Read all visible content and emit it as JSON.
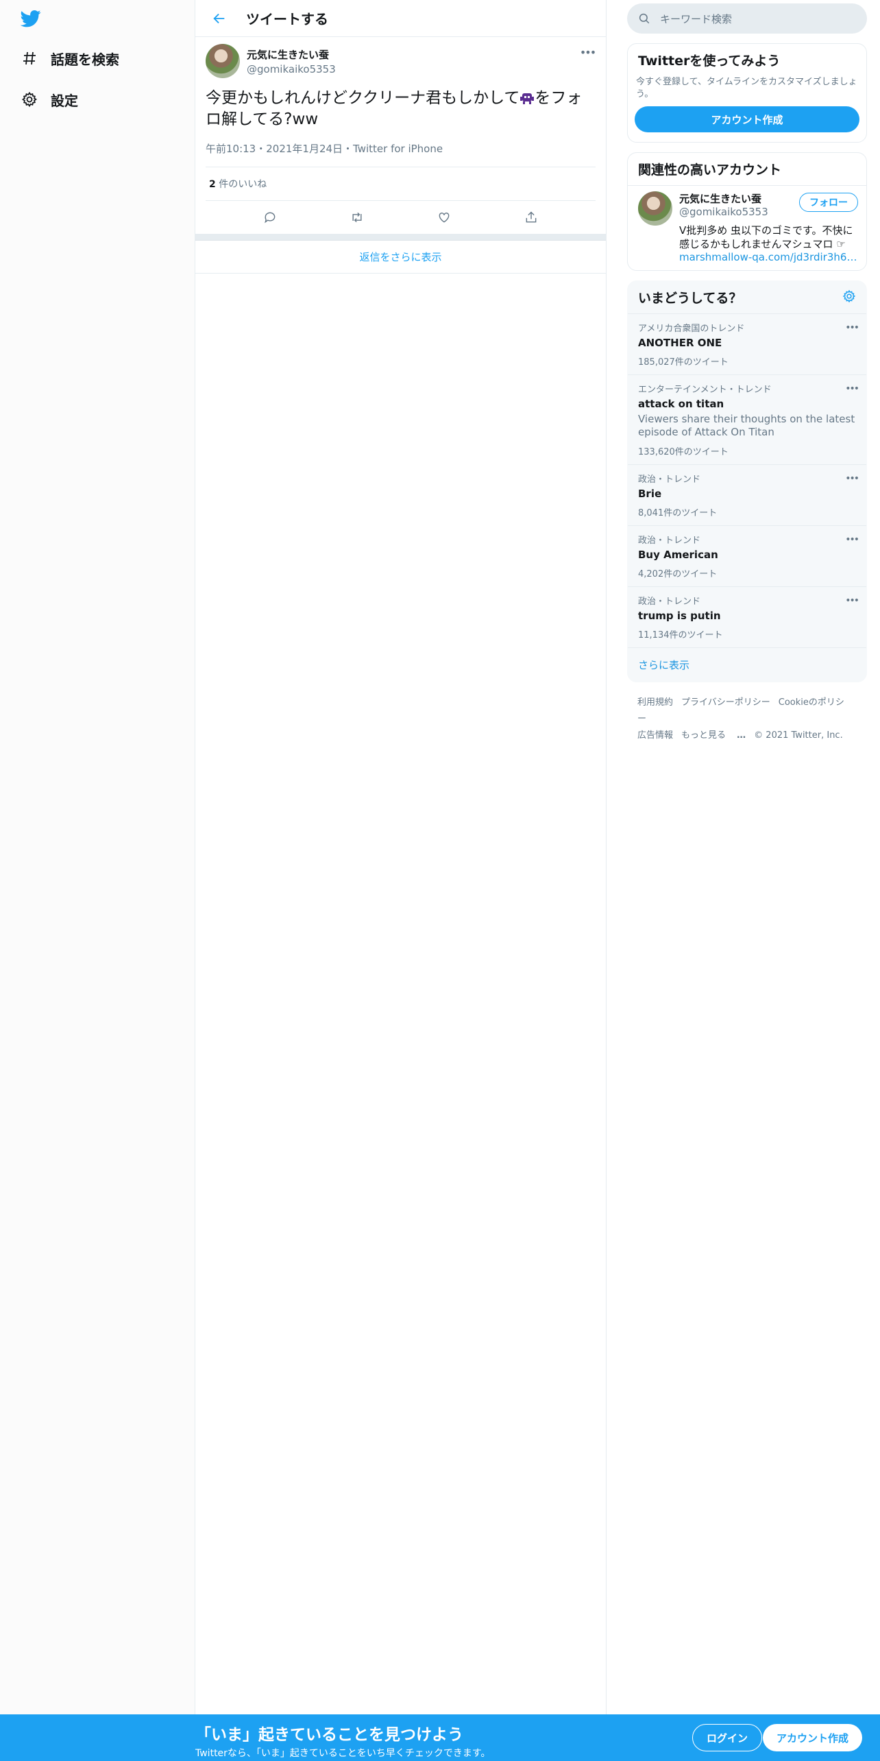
{
  "nav": {
    "items": [
      {
        "label": "話題を検索",
        "icon": "hashtag-icon"
      },
      {
        "label": "設定",
        "icon": "gear-icon"
      }
    ]
  },
  "header": {
    "title": "ツイートする"
  },
  "tweet": {
    "author_name": "元気に生きたい蚕",
    "author_handle": "@gomikaiko5353",
    "text_before": "今更かもしれんけどククリーナ君もしかして",
    "text_after": "をフォロ解してる?ww",
    "meta": "午前10:13・2021年1月24日・Twitter for iPhone",
    "likes_count": "2",
    "likes_label": "件のいいね"
  },
  "show_more_replies": "返信をさらに表示",
  "sidebar": {
    "search_placeholder": "キーワード検索",
    "signup_card": {
      "title": "Twitterを使ってみよう",
      "desc": "今すぐ登録して、タイムラインをカスタマイズしましょう。",
      "button": "アカウント作成"
    },
    "related": {
      "title": "関連性の高いアカウント",
      "name": "元気に生きたい蚕",
      "handle": "@gomikaiko5353",
      "follow": "フォロー",
      "bio_line1": "V批判多め 虫以下のゴミです。不快に",
      "bio_line2": "感じるかもしれませんマシュマロ ☞",
      "link": "marshmallow-qa.com/jd3rdir3h65t2qa…"
    },
    "trends": {
      "title": "いまどうしてる？",
      "items": [
        {
          "context": "アメリカ合衆国のトレンド",
          "name": "ANOTHER ONE",
          "desc": "",
          "count": "185,027件のツイート"
        },
        {
          "context": "エンターテインメント・トレンド",
          "name": "attack on titan",
          "desc": "Viewers share their thoughts on the latest episode of Attack On Titan",
          "count": "133,620件のツイート"
        },
        {
          "context": "政治・トレンド",
          "name": "Brie",
          "desc": "",
          "count": "8,041件のツイート"
        },
        {
          "context": "政治・トレンド",
          "name": "Buy American",
          "desc": "",
          "count": "4,202件のツイート"
        },
        {
          "context": "政治・トレンド",
          "name": "trump is putin",
          "desc": "",
          "count": "11,134件のツイート"
        }
      ],
      "show_more": "さらに表示"
    },
    "footer": {
      "links": [
        "利用規約",
        "プライバシーポリシー",
        "Cookieのポリシー",
        "広告情報",
        "もっと見る"
      ],
      "copyright": "© 2021 Twitter, Inc."
    }
  },
  "bottom_bar": {
    "title": "「いま」起きていることを見つけよう",
    "subtitle": "Twitterなら、「いま」起きていることをいち早くチェックできます。",
    "login": "ログイン",
    "signup": "アカウント作成"
  },
  "colors": {
    "accent": "#1da1f2",
    "text": "#14171a",
    "muted": "#657786",
    "border": "#e6ecf0"
  }
}
